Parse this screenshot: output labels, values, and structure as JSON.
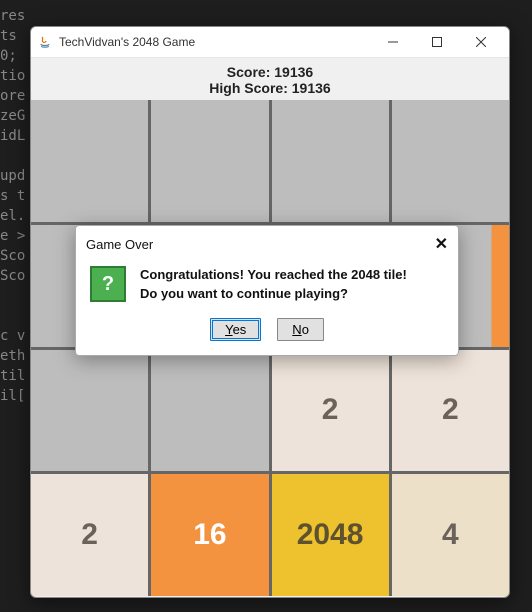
{
  "code_lines": [
    "res",
    "ts",
    "0;",
    "tio",
    "ore",
    "zeG",
    "idL",
    "",
    "upd",
    "s t",
    "el.",
    "e >",
    "Sco",
    "Sco",
    "",
    "",
    "c v",
    "eth",
    "til",
    "il["
  ],
  "window": {
    "title": "TechVidvan's 2048 Game",
    "score_label": "Score: 19136",
    "highscore_label": "High Score: 19136"
  },
  "grid": [
    [
      "",
      "",
      "",
      ""
    ],
    [
      "",
      "",
      "",
      ""
    ],
    [
      "",
      "",
      "2",
      "2"
    ],
    [
      "2",
      "16",
      "2048",
      "4"
    ]
  ],
  "dialog": {
    "title": "Game Over",
    "line1": "Congratulations! You reached the 2048 tile!",
    "line2": "Do you want to continue playing?",
    "yes": "Yes",
    "no": "No"
  }
}
